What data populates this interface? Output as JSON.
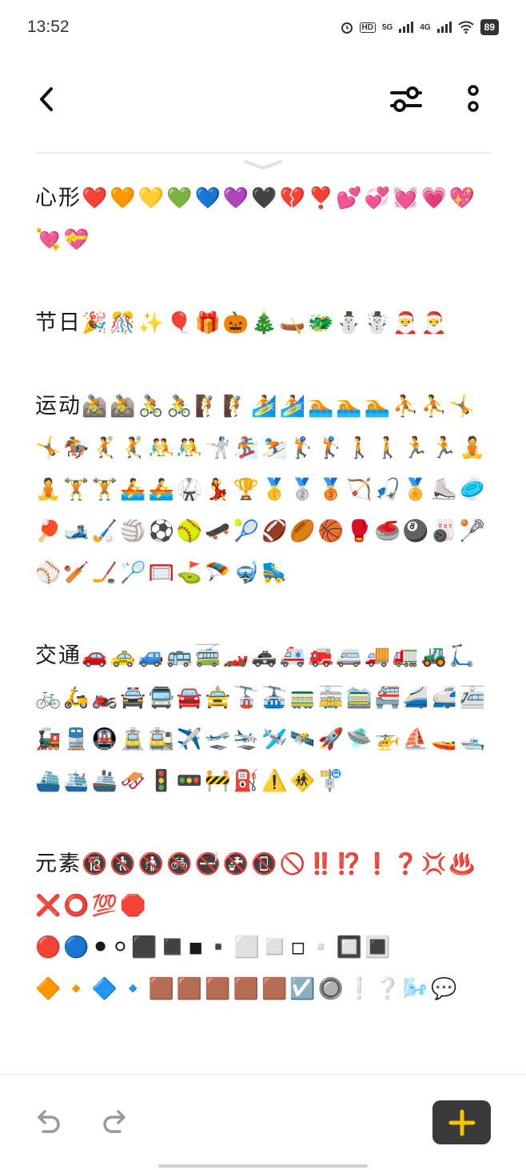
{
  "status_bar": {
    "time": "13:52",
    "hd_label": "HD",
    "sim1_label": "5G",
    "sim2_label": "4G",
    "battery_level": "89"
  },
  "toolbar": {
    "back_icon": "chevron-left-icon",
    "filter_icon": "sliders-icon",
    "more_icon": "more-vertical-icon"
  },
  "sections": [
    {
      "title": "心形",
      "emoji": "❤️🧡💛💚💙💜🖤💔❣️💕💞💓💗💖💘💝"
    },
    {
      "title": "节日",
      "emoji": "🎉🎊✨🎈🎁🎃🎄🛶🐲⛄☃️🎅🎅"
    },
    {
      "title": "运动",
      "emoji": "🚵🚵🚴🚴🧗🧗🏄🏄🏊🏊🏊⛹️⛹️🤸🤸🏇🤾🤾🤼🤼🤺🏂⛷️🏌️🏌️🚶🚶🏃🏃🧘🧘🏋️🏋️🚣🚣🥋💃🏆🥇🥈🥉🏹🎣🏅⛸️🥏🏓🎿🏑🏐⚽🥎🛹🎾🏈🏉🏀🥊🥌🎱🎳🥍⚾🏏🏒🏸🥅⛳🪂🤿🛼"
    },
    {
      "title": "交通",
      "emoji": "🚗🚕🚙🚌🚎🏎️🚓🚑🚒🚐🚚🚛🚜🛴🚲🛵🏍️🚔🚍🚘🚖🚡🚠🚃🚋🚞🚝🚄🚅🚈🚂🚆🚇🚊🚉✈️🛫🛬🛩️🛰️🚀🛸🚁⛵🚤🛥️⛴️🛳️🚢🛷🚦🚥🚧⛽⚠️🚸🚏"
    },
    {
      "title": "元素",
      "emoji": "🔞🚷🚯🚳🚭🚱📵🚫‼️⁉️❗❓💢♨️❌⭕💯🛑"
    }
  ],
  "extra_rows": [
    "🔴🔵⚫⚪⬛◼️◾▪️⬜◻️◽▫️🔲🔳",
    "🔶🔸🔷🔹🟫🟫🟫🟫🟫☑️🔘❕❔🌬️💬"
  ],
  "bottom_bar": {
    "undo_icon": "undo-icon",
    "redo_icon": "redo-icon",
    "add_icon": "plus-icon",
    "accent_color": "#f5c400",
    "add_button_color": "#3a3a3a"
  }
}
